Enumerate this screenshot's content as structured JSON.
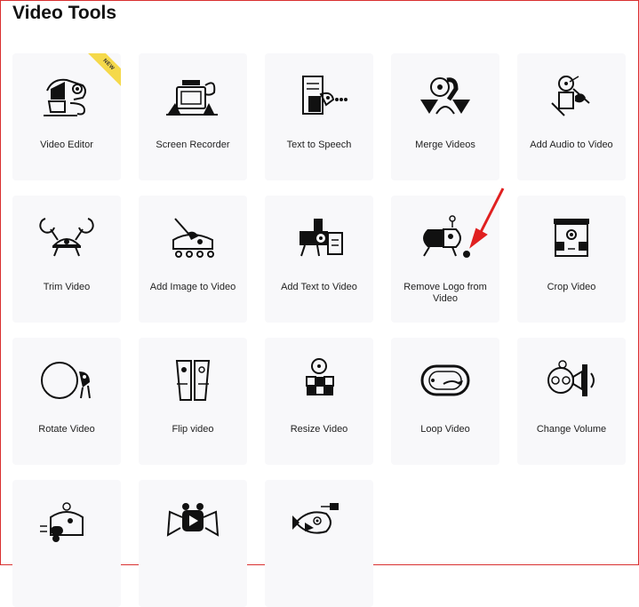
{
  "page": {
    "title": "Video Tools"
  },
  "badge": {
    "new_label": "NEW"
  },
  "accent": {
    "badge_color": "#f5d94a",
    "arrow_color": "#e02020"
  },
  "tools": [
    {
      "label": "Video Editor",
      "icon": "chameleon-icon"
    },
    {
      "label": "Screen Recorder",
      "icon": "recorder-creature-icon"
    },
    {
      "label": "Text to Speech",
      "icon": "scroll-creature-icon"
    },
    {
      "label": "Merge Videos",
      "icon": "merge-creature-icon"
    },
    {
      "label": "Add Audio to Video",
      "icon": "violin-creature-icon"
    },
    {
      "label": "Trim Video",
      "icon": "crab-icon"
    },
    {
      "label": "Add Image to Video",
      "icon": "brush-creature-icon"
    },
    {
      "label": "Add Text to Video",
      "icon": "projector-creature-icon"
    },
    {
      "label": "Remove Logo from Video",
      "icon": "eraser-creature-icon"
    },
    {
      "label": "Crop Video",
      "icon": "crop-face-icon"
    },
    {
      "label": "Rotate Video",
      "icon": "ball-creature-icon"
    },
    {
      "label": "Flip video",
      "icon": "mirror-faces-icon"
    },
    {
      "label": "Resize Video",
      "icon": "blocks-face-icon"
    },
    {
      "label": "Loop Video",
      "icon": "loop-creature-icon"
    },
    {
      "label": "Change Volume",
      "icon": "horn-creature-icon"
    },
    {
      "label": "",
      "icon": "speed-rabbit-icon"
    },
    {
      "label": "",
      "icon": "play-frog-icon"
    },
    {
      "label": "",
      "icon": "fish-camera-icon"
    }
  ]
}
